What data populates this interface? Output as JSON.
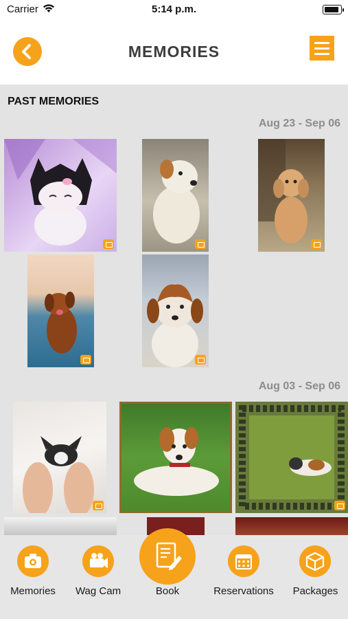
{
  "status_bar": {
    "carrier": "Carrier",
    "time": "5:14 p.m."
  },
  "header": {
    "title": "MEMORIES"
  },
  "section": {
    "title": "PAST MEMORIES"
  },
  "groups": [
    {
      "date_range": "Aug 23 - Sep 06",
      "photos": [
        "kuromi plush",
        "white dog",
        "poodle puppy",
        "dog running on beach",
        "brown and white puppy"
      ]
    },
    {
      "date_range": "Aug 03 - Sep 06",
      "photos": [
        "puppy in hands",
        "jack russell on grass",
        "cat jumping in frame",
        "photo",
        "photo",
        "photo"
      ]
    }
  ],
  "tabs": [
    {
      "label": "Memories",
      "icon": "camera-icon"
    },
    {
      "label": "Wag Cam",
      "icon": "video-camera-icon"
    },
    {
      "label": "Book",
      "icon": "book-edit-icon"
    },
    {
      "label": "Reservations",
      "icon": "calendar-icon"
    },
    {
      "label": "Packages",
      "icon": "package-icon"
    }
  ],
  "colors": {
    "accent": "#f7a21b",
    "content_bg": "#e3e3e3",
    "tab_bg": "#e6e6e6"
  }
}
